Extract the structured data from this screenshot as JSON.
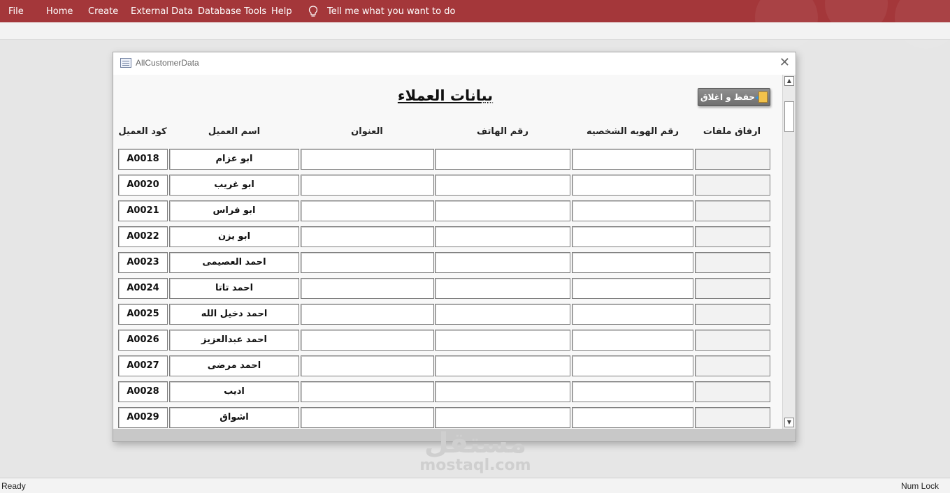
{
  "ribbon": {
    "tabs": [
      "File",
      "Home",
      "Create",
      "External Data",
      "Database Tools",
      "Help"
    ],
    "tell_me": "Tell me what you want to do",
    "color": "#a4373a"
  },
  "window": {
    "title": "AllCustomerData",
    "icon": "form-icon",
    "close_icon": "close-icon"
  },
  "form": {
    "title": "بيانات العملاء",
    "save_button": "حفظ و اغلاق",
    "columns": {
      "code": "كود العميل",
      "name": "اسم العميل",
      "address": "العنوان",
      "phone": "رقم الهاتف",
      "id_number": "رقم الهويه الشخصيه",
      "attachments": "ارفاق ملفات"
    },
    "rows": [
      {
        "code": "A0018",
        "name": "ابو عزام",
        "address": "",
        "phone": "",
        "id_number": "",
        "attachments": ""
      },
      {
        "code": "A0020",
        "name": "ابو غريب",
        "address": "",
        "phone": "",
        "id_number": "",
        "attachments": ""
      },
      {
        "code": "A0021",
        "name": "ابو فراس",
        "address": "",
        "phone": "",
        "id_number": "",
        "attachments": ""
      },
      {
        "code": "A0022",
        "name": "ابو يزن",
        "address": "",
        "phone": "",
        "id_number": "",
        "attachments": ""
      },
      {
        "code": "A0023",
        "name": "احمد العصيمى",
        "address": "",
        "phone": "",
        "id_number": "",
        "attachments": ""
      },
      {
        "code": "A0024",
        "name": "احمد تاتا",
        "address": "",
        "phone": "",
        "id_number": "",
        "attachments": ""
      },
      {
        "code": "A0025",
        "name": "احمد دخيل الله",
        "address": "",
        "phone": "",
        "id_number": "",
        "attachments": ""
      },
      {
        "code": "A0026",
        "name": "احمد عبدالعزيز",
        "address": "",
        "phone": "",
        "id_number": "",
        "attachments": ""
      },
      {
        "code": "A0027",
        "name": "احمد مرضى",
        "address": "",
        "phone": "",
        "id_number": "",
        "attachments": ""
      },
      {
        "code": "A0028",
        "name": "اديب",
        "address": "",
        "phone": "",
        "id_number": "",
        "attachments": ""
      },
      {
        "code": "A0029",
        "name": "اشواق",
        "address": "",
        "phone": "",
        "id_number": "",
        "attachments": ""
      }
    ]
  },
  "watermark": {
    "arabic": "مستقل",
    "latin": "mostaql.com"
  },
  "status": {
    "left": "Ready",
    "right": "Num Lock"
  }
}
